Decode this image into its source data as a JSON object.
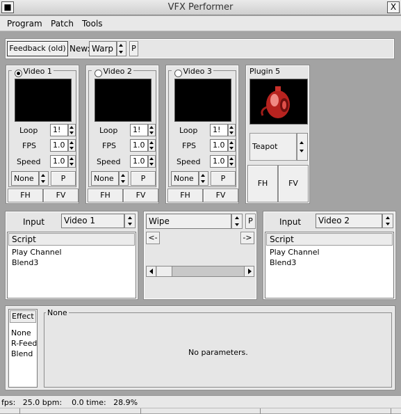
{
  "window": {
    "title": "VFX Performer",
    "close_glyph": "X"
  },
  "menu": [
    "Program",
    "Patch",
    "Tools"
  ],
  "toolbar": {
    "feedback_label": "Feedback (old)",
    "new_label": "New:",
    "new_value": "Warp",
    "p_label": "P"
  },
  "videos": [
    {
      "title": "Video 1",
      "selected": true,
      "loop_label": "Loop",
      "loop_value": "1!",
      "fps_label": "FPS",
      "fps_value": "1.0",
      "speed_label": "Speed",
      "speed_value": "1.0",
      "blend_value": "None",
      "p_label": "P",
      "fh_label": "FH",
      "fv_label": "FV"
    },
    {
      "title": "Video 2",
      "selected": false,
      "loop_label": "Loop",
      "loop_value": "1!",
      "fps_label": "FPS",
      "fps_value": "1.0",
      "speed_label": "Speed",
      "speed_value": "1.0",
      "blend_value": "None",
      "p_label": "P",
      "fh_label": "FH",
      "fv_label": "FV"
    },
    {
      "title": "Video 3",
      "selected": false,
      "loop_label": "Loop",
      "loop_value": "1!",
      "fps_label": "FPS",
      "fps_value": "1.0",
      "speed_label": "Speed",
      "speed_value": "1.0",
      "blend_value": "None",
      "p_label": "P",
      "fh_label": "FH",
      "fv_label": "FV"
    }
  ],
  "plugin": {
    "title": "Plugin 5",
    "model_value": "Teapot",
    "fh_label": "FH",
    "fv_label": "FV"
  },
  "left_input": {
    "input_label": "Input",
    "input_value": "Video 1",
    "script_header": "Script",
    "items": [
      "Play Channel",
      "Blend3"
    ]
  },
  "transition": {
    "value": "Wipe",
    "p_label": "P",
    "left_label": "<-",
    "right_label": "->"
  },
  "right_input": {
    "input_label": "Input",
    "input_value": "Video 2",
    "script_header": "Script",
    "items": [
      "Play Channel",
      "Blend3"
    ]
  },
  "effects": {
    "header": "Effect",
    "items": [
      "None",
      "R-Feedback",
      "Blend"
    ],
    "params_title": "None",
    "params_message": "No parameters."
  },
  "status": {
    "text": "fps:   25.0 bpm:    0.0 time:   28.9%"
  },
  "colors": {
    "background": "#a3a3a3",
    "panel": "#e6e6e6",
    "teapot_red": "#d8322e"
  },
  "icons": [
    "close-icon",
    "spin-arrows-icon",
    "radio-icon",
    "scroll-left-icon",
    "scroll-right-icon",
    "teapot-thumbnail"
  ]
}
